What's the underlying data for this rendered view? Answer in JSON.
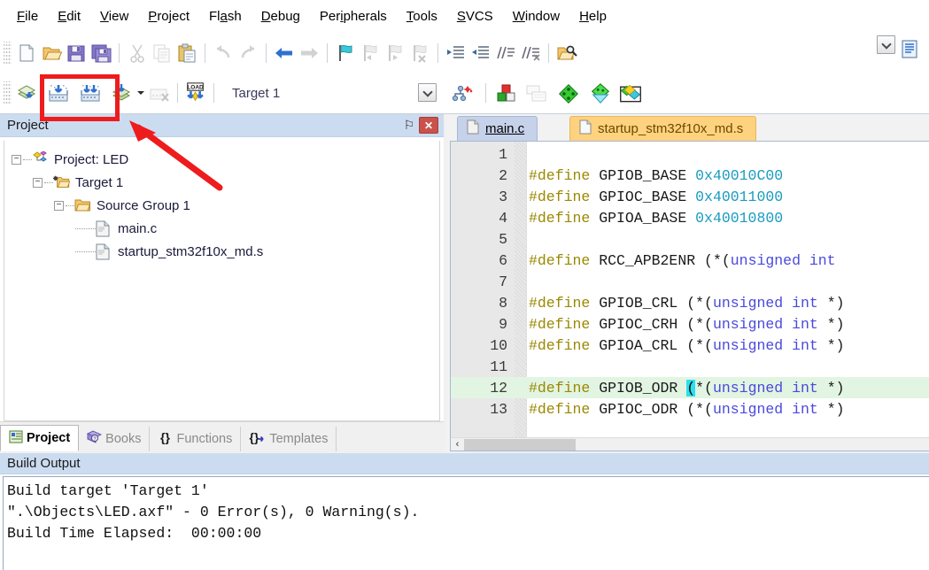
{
  "menu": {
    "items": [
      {
        "pre": "",
        "hot": "F",
        "post": "ile"
      },
      {
        "pre": "",
        "hot": "E",
        "post": "dit"
      },
      {
        "pre": "",
        "hot": "V",
        "post": "iew"
      },
      {
        "pre": "",
        "hot": "P",
        "post": "roject"
      },
      {
        "pre": "Fl",
        "hot": "a",
        "post": "sh"
      },
      {
        "pre": "",
        "hot": "D",
        "post": "ebug"
      },
      {
        "pre": "Per",
        "hot": "i",
        "post": "pherals"
      },
      {
        "pre": "",
        "hot": "T",
        "post": "ools"
      },
      {
        "pre": "",
        "hot": "S",
        "post": "VCS"
      },
      {
        "pre": "",
        "hot": "W",
        "post": "indow"
      },
      {
        "pre": "",
        "hot": "H",
        "post": "elp"
      }
    ]
  },
  "toolbar_file": {
    "buttons": [
      {
        "name": "new-file-icon",
        "label": "New"
      },
      {
        "name": "open-file-icon",
        "label": "Open"
      },
      {
        "name": "save-icon",
        "label": "Save"
      },
      {
        "name": "save-all-icon",
        "label": "Save All"
      },
      {
        "name": "cut-icon",
        "label": "Cut"
      },
      {
        "name": "copy-icon",
        "label": "Copy"
      },
      {
        "name": "paste-icon",
        "label": "Paste"
      },
      {
        "name": "undo-icon",
        "label": "Undo"
      },
      {
        "name": "redo-icon",
        "label": "Redo"
      },
      {
        "name": "back-arrow-icon",
        "label": "Navigate Backwards"
      },
      {
        "name": "forward-arrow-icon",
        "label": "Navigate Forwards"
      },
      {
        "name": "bookmark-toggle-icon",
        "label": "Insert/Remove Bookmark"
      },
      {
        "name": "bookmark-prev-icon",
        "label": "Previous Bookmark"
      },
      {
        "name": "bookmark-next-icon",
        "label": "Next Bookmark"
      },
      {
        "name": "bookmark-clear-icon",
        "label": "Clear All Bookmarks"
      },
      {
        "name": "indent-icon",
        "label": "Indent"
      },
      {
        "name": "outdent-icon",
        "label": "Outdent"
      },
      {
        "name": "comment-icon",
        "label": "Comment"
      },
      {
        "name": "uncomment-icon",
        "label": "Uncomment"
      },
      {
        "name": "find-in-files-icon",
        "label": "Find in Files"
      }
    ]
  },
  "toolbar_build": {
    "buttons": [
      {
        "name": "translate-icon",
        "label": "Translate"
      },
      {
        "name": "build-icon",
        "label": "Build"
      },
      {
        "name": "rebuild-icon",
        "label": "Rebuild"
      },
      {
        "name": "batch-build-icon",
        "label": "Batch Build"
      },
      {
        "name": "batch-build-dropdown-icon",
        "label": "Batch Build Options"
      },
      {
        "name": "stop-build-icon",
        "label": "Stop Build"
      },
      {
        "name": "download-icon",
        "label": "Download"
      },
      {
        "name": "target-options-icon",
        "label": "Options for Target"
      },
      {
        "name": "manage-components-icon",
        "label": "Manage Project Items"
      },
      {
        "name": "multi-project-icon",
        "label": "Multi-Project"
      },
      {
        "name": "pack-installer-icon",
        "label": "Pack Installer"
      },
      {
        "name": "run-to-icon",
        "label": "Configure Flash Tools"
      },
      {
        "name": "env-icon",
        "label": "Manage Run-Time Environment"
      }
    ],
    "target_value": "Target 1",
    "load_label": "LOAD"
  },
  "project_panel": {
    "title": "Project",
    "pin_label": "⚐",
    "close_label": "✕",
    "tree": [
      {
        "indent": 0,
        "expander": "−",
        "icon": "project-icon",
        "label": "Project: LED"
      },
      {
        "indent": 1,
        "expander": "−",
        "icon": "target-folder-icon",
        "label": "Target 1"
      },
      {
        "indent": 2,
        "expander": "−",
        "icon": "folder-icon",
        "label": "Source Group 1"
      },
      {
        "indent": 3,
        "expander": "",
        "icon": "c-file-icon",
        "label": "main.c"
      },
      {
        "indent": 3,
        "expander": "",
        "icon": "asm-file-icon",
        "label": "startup_stm32f10x_md.s"
      }
    ],
    "tabs": [
      {
        "label": "Project",
        "icon": "project-tab-icon",
        "active": true
      },
      {
        "label": "Books",
        "icon": "books-icon",
        "active": false
      },
      {
        "label": "Functions",
        "icon": "braces-icon",
        "active": false
      },
      {
        "label": "Templates",
        "icon": "templates-icon",
        "active": false
      }
    ]
  },
  "editor": {
    "tabs": [
      {
        "label": "main.c",
        "active": true,
        "icon": "c-file-icon"
      },
      {
        "label": "startup_stm32f10x_md.s",
        "active": false,
        "icon": "asm-file-icon"
      }
    ],
    "lines": [
      {
        "num": "1",
        "current": false,
        "tokens": []
      },
      {
        "num": "2",
        "current": false,
        "tokens": [
          {
            "t": "#define ",
            "c": "define"
          },
          {
            "t": "GPIOB_BASE ",
            "c": "id"
          },
          {
            "t": "0x40010C00",
            "c": "hex"
          }
        ]
      },
      {
        "num": "3",
        "current": false,
        "tokens": [
          {
            "t": "#define ",
            "c": "define"
          },
          {
            "t": "GPIOC_BASE ",
            "c": "id"
          },
          {
            "t": "0x40011000",
            "c": "hex"
          }
        ]
      },
      {
        "num": "4",
        "current": false,
        "tokens": [
          {
            "t": "#define ",
            "c": "define"
          },
          {
            "t": "GPIOA_BASE ",
            "c": "id"
          },
          {
            "t": "0x40010800",
            "c": "hex"
          }
        ]
      },
      {
        "num": "5",
        "current": false,
        "tokens": []
      },
      {
        "num": "6",
        "current": false,
        "tokens": [
          {
            "t": "#define ",
            "c": "define"
          },
          {
            "t": "RCC_APB2ENR ",
            "c": "id"
          },
          {
            "t": "(*(",
            "c": "punc"
          },
          {
            "t": "unsigned int",
            "c": "kw"
          }
        ]
      },
      {
        "num": "7",
        "current": false,
        "tokens": []
      },
      {
        "num": "8",
        "current": false,
        "tokens": [
          {
            "t": "#define ",
            "c": "define"
          },
          {
            "t": "GPIOB_CRL ",
            "c": "id"
          },
          {
            "t": "(*(",
            "c": "punc"
          },
          {
            "t": "unsigned int",
            "c": "kw"
          },
          {
            "t": " *)",
            "c": "punc"
          }
        ]
      },
      {
        "num": "9",
        "current": false,
        "tokens": [
          {
            "t": "#define ",
            "c": "define"
          },
          {
            "t": "GPIOC_CRH ",
            "c": "id"
          },
          {
            "t": "(*(",
            "c": "punc"
          },
          {
            "t": "unsigned int",
            "c": "kw"
          },
          {
            "t": " *)",
            "c": "punc"
          }
        ]
      },
      {
        "num": "10",
        "current": false,
        "tokens": [
          {
            "t": "#define ",
            "c": "define"
          },
          {
            "t": "GPIOA_CRL ",
            "c": "id"
          },
          {
            "t": "(*(",
            "c": "punc"
          },
          {
            "t": "unsigned int",
            "c": "kw"
          },
          {
            "t": " *)",
            "c": "punc"
          }
        ]
      },
      {
        "num": "11",
        "current": false,
        "tokens": []
      },
      {
        "num": "12",
        "current": true,
        "tokens": [
          {
            "t": "#define ",
            "c": "define"
          },
          {
            "t": "GPIOB_ODR ",
            "c": "id"
          },
          {
            "t": "(",
            "c": "match"
          },
          {
            "t": "*(",
            "c": "punc"
          },
          {
            "t": "unsigned int",
            "c": "kw"
          },
          {
            "t": " *)",
            "c": "punc"
          }
        ]
      },
      {
        "num": "13",
        "current": false,
        "tokens": [
          {
            "t": "#define ",
            "c": "define"
          },
          {
            "t": "GPIOC_ODR ",
            "c": "id"
          },
          {
            "t": "(*(",
            "c": "punc"
          },
          {
            "t": "unsigned int",
            "c": "kw"
          },
          {
            "t": " *)",
            "c": "punc"
          }
        ]
      }
    ],
    "hscroll_left": "‹"
  },
  "build_output": {
    "title": "Build Output",
    "text": "Build target 'Target 1'\n\".\\Objects\\LED.axf\" - 0 Error(s), 0 Warning(s).\nBuild Time Elapsed:  00:00:00"
  },
  "annotations": {
    "highlight_color": "#ee1c1c",
    "rect_name": "build-buttons-highlight",
    "arrow_name": "pointer-arrow"
  }
}
